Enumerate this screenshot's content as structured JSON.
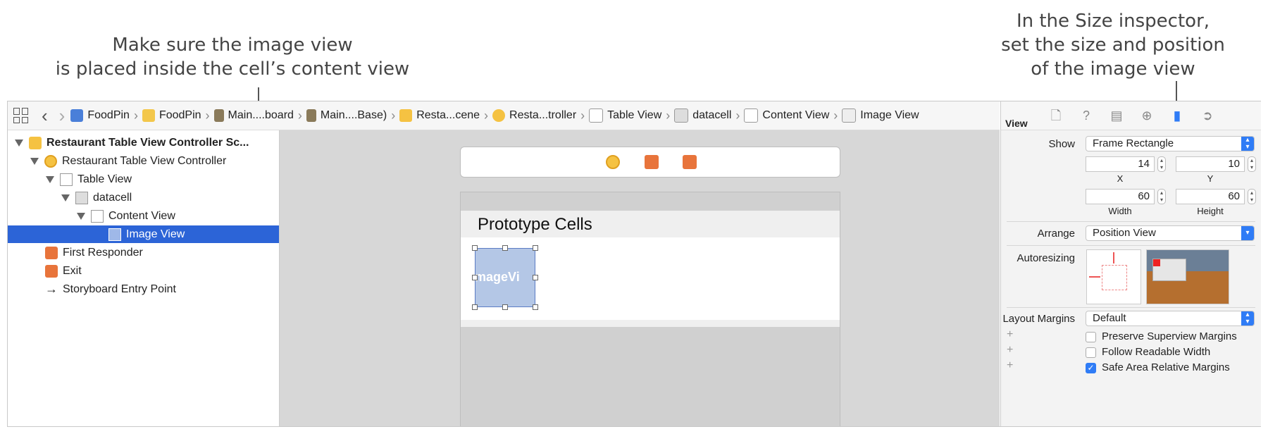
{
  "annotations": {
    "left": [
      "Make sure the image view",
      "is placed inside the cell’s content view"
    ],
    "right": [
      "In the Size inspector,",
      "set the size and position",
      "of the image view"
    ]
  },
  "breadcrumb": {
    "items": [
      "FoodPin",
      "FoodPin",
      "Main....board",
      "Main....Base)",
      "Resta...cene",
      "Resta...troller",
      "Table View",
      "datacell",
      "Content View",
      "Image View"
    ]
  },
  "navigator": {
    "items": [
      {
        "label": "Restaurant Table View Controller Sc...",
        "icon": "scene-icon"
      },
      {
        "label": "Restaurant Table View Controller",
        "icon": "view-controller-icon"
      },
      {
        "label": "Table View",
        "icon": "table-view-icon"
      },
      {
        "label": "datacell",
        "icon": "table-cell-icon"
      },
      {
        "label": "Content View",
        "icon": "view-icon"
      },
      {
        "label": "Image View",
        "icon": "image-view-icon",
        "selected": true
      },
      {
        "label": "First Responder",
        "icon": "first-responder-icon"
      },
      {
        "label": "Exit",
        "icon": "exit-icon"
      },
      {
        "label": "Storyboard Entry Point",
        "icon": "arrow-right-icon"
      }
    ]
  },
  "canvas": {
    "section_title": "Prototype Cells",
    "image_view_label": "ImageVi"
  },
  "inspector": {
    "section_title": "View",
    "show_label": "Show",
    "show_value": "Frame Rectangle",
    "x_value": "14",
    "y_value": "10",
    "x_label": "X",
    "y_label": "Y",
    "width_value": "60",
    "height_value": "60",
    "width_label": "Width",
    "height_label": "Height",
    "arrange_label": "Arrange",
    "arrange_value": "Position View",
    "autoresizing_label": "Autoresizing",
    "layout_margins_label": "Layout Margins",
    "layout_margins_value": "Default",
    "checkboxes": [
      {
        "label": "Preserve Superview Margins",
        "checked": false
      },
      {
        "label": "Follow Readable Width",
        "checked": false
      },
      {
        "label": "Safe Area Relative Margins",
        "checked": true
      }
    ]
  },
  "colors": {
    "selection": "#2c64d7",
    "accent": "#2f7cf6",
    "scene_icon": "#f5c242",
    "object_icon": "#e8743b"
  }
}
